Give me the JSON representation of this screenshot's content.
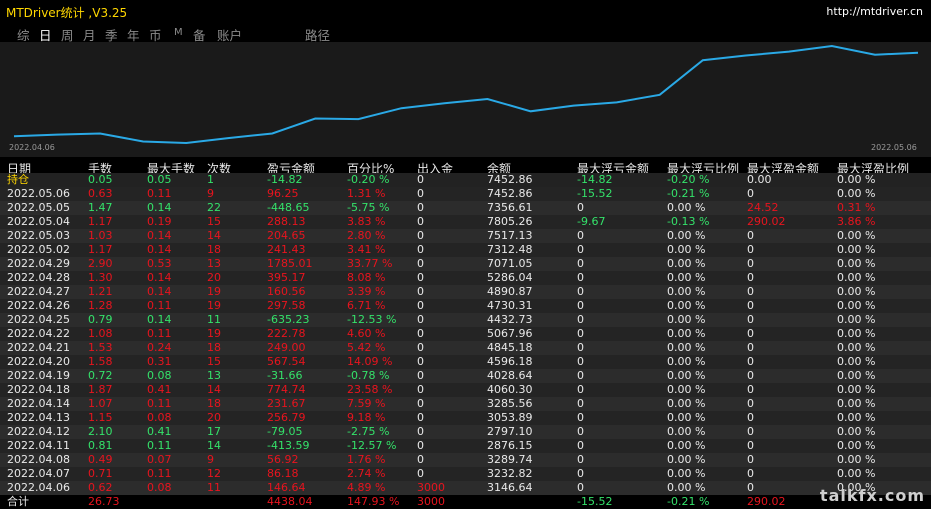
{
  "app": {
    "title": "MTDriver统计 ,V3.25",
    "url": "http://mtdriver.cn"
  },
  "tabs": [
    {
      "label": "综",
      "active": false
    },
    {
      "label": "日",
      "active": true
    },
    {
      "label": "周",
      "active": false
    },
    {
      "label": "月",
      "active": false
    },
    {
      "label": "季",
      "active": false
    },
    {
      "label": "年",
      "active": false
    },
    {
      "label": "币",
      "active": false
    },
    {
      "label": "M",
      "active": false
    },
    {
      "label": "备",
      "active": false
    },
    {
      "label": "账户",
      "active": false
    },
    {
      "label": "路径",
      "active": false
    }
  ],
  "chart_data": {
    "type": "line",
    "x_start": "2022.04.06",
    "x_end": "2022.05.06",
    "values": [
      3146.64,
      3232.82,
      3289.74,
      2876.15,
      2797.1,
      3053.89,
      3285.56,
      4060.3,
      4028.64,
      4596.18,
      4845.18,
      5067.96,
      4432.73,
      4730.31,
      4890.87,
      5286.04,
      7071.05,
      7312.48,
      7517.13,
      7805.26,
      7356.61,
      7452.86
    ],
    "color": "#2aa9e6"
  },
  "table": {
    "headers": [
      "日期",
      "手数",
      "最大手数",
      "次数",
      "盈亏金额",
      "百分比%",
      "出入金",
      "余额",
      "最大浮亏金额",
      "最大浮亏比例",
      "最大浮盈金额",
      "最大浮盈比例"
    ],
    "rows": [
      {
        "c": [
          "持仓",
          "0.05",
          "0.05",
          "1",
          "-14.82",
          "-0.20 %",
          "0",
          "7452.86",
          "-14.82",
          "-0.20 %",
          "0.00",
          "0.00 %"
        ],
        "k": [
          "y",
          "g",
          "g",
          "g",
          "g",
          "g",
          "w",
          "w",
          "g",
          "g",
          "w",
          "w"
        ]
      },
      {
        "c": [
          "2022.05.06",
          "0.63",
          "0.11",
          "9",
          "96.25",
          "1.31 %",
          "0",
          "7452.86",
          "-15.52",
          "-0.21 %",
          "0",
          "0.00 %"
        ],
        "k": [
          "w",
          "r",
          "r",
          "r",
          "r",
          "r",
          "w",
          "w",
          "g",
          "g",
          "w",
          "w"
        ]
      },
      {
        "c": [
          "2022.05.05",
          "1.47",
          "0.14",
          "22",
          "-448.65",
          "-5.75 %",
          "0",
          "7356.61",
          "0",
          "0.00 %",
          "24.52",
          "0.31 %"
        ],
        "k": [
          "w",
          "g",
          "g",
          "g",
          "g",
          "g",
          "w",
          "w",
          "w",
          "w",
          "r",
          "r"
        ]
      },
      {
        "c": [
          "2022.05.04",
          "1.17",
          "0.19",
          "15",
          "288.13",
          "3.83 %",
          "0",
          "7805.26",
          "-9.67",
          "-0.13 %",
          "290.02",
          "3.86 %"
        ],
        "k": [
          "w",
          "r",
          "r",
          "r",
          "r",
          "r",
          "w",
          "w",
          "g",
          "g",
          "r",
          "r"
        ]
      },
      {
        "c": [
          "2022.05.03",
          "1.03",
          "0.14",
          "14",
          "204.65",
          "2.80 %",
          "0",
          "7517.13",
          "0",
          "0.00 %",
          "0",
          "0.00 %"
        ],
        "k": [
          "w",
          "r",
          "r",
          "r",
          "r",
          "r",
          "w",
          "w",
          "w",
          "w",
          "w",
          "w"
        ]
      },
      {
        "c": [
          "2022.05.02",
          "1.17",
          "0.14",
          "18",
          "241.43",
          "3.41 %",
          "0",
          "7312.48",
          "0",
          "0.00 %",
          "0",
          "0.00 %"
        ],
        "k": [
          "w",
          "r",
          "r",
          "r",
          "r",
          "r",
          "w",
          "w",
          "w",
          "w",
          "w",
          "w"
        ]
      },
      {
        "c": [
          "2022.04.29",
          "2.90",
          "0.53",
          "13",
          "1785.01",
          "33.77 %",
          "0",
          "7071.05",
          "0",
          "0.00 %",
          "0",
          "0.00 %"
        ],
        "k": [
          "w",
          "r",
          "r",
          "r",
          "r",
          "r",
          "w",
          "w",
          "w",
          "w",
          "w",
          "w"
        ]
      },
      {
        "c": [
          "2022.04.28",
          "1.30",
          "0.14",
          "20",
          "395.17",
          "8.08 %",
          "0",
          "5286.04",
          "0",
          "0.00 %",
          "0",
          "0.00 %"
        ],
        "k": [
          "w",
          "r",
          "r",
          "r",
          "r",
          "r",
          "w",
          "w",
          "w",
          "w",
          "w",
          "w"
        ]
      },
      {
        "c": [
          "2022.04.27",
          "1.21",
          "0.14",
          "19",
          "160.56",
          "3.39 %",
          "0",
          "4890.87",
          "0",
          "0.00 %",
          "0",
          "0.00 %"
        ],
        "k": [
          "w",
          "r",
          "r",
          "r",
          "r",
          "r",
          "w",
          "w",
          "w",
          "w",
          "w",
          "w"
        ]
      },
      {
        "c": [
          "2022.04.26",
          "1.28",
          "0.11",
          "19",
          "297.58",
          "6.71 %",
          "0",
          "4730.31",
          "0",
          "0.00 %",
          "0",
          "0.00 %"
        ],
        "k": [
          "w",
          "r",
          "r",
          "r",
          "r",
          "r",
          "w",
          "w",
          "w",
          "w",
          "w",
          "w"
        ]
      },
      {
        "c": [
          "2022.04.25",
          "0.79",
          "0.14",
          "11",
          "-635.23",
          "-12.53 %",
          "0",
          "4432.73",
          "0",
          "0.00 %",
          "0",
          "0.00 %"
        ],
        "k": [
          "w",
          "g",
          "g",
          "g",
          "g",
          "g",
          "w",
          "w",
          "w",
          "w",
          "w",
          "w"
        ]
      },
      {
        "c": [
          "2022.04.22",
          "1.08",
          "0.11",
          "19",
          "222.78",
          "4.60 %",
          "0",
          "5067.96",
          "0",
          "0.00 %",
          "0",
          "0.00 %"
        ],
        "k": [
          "w",
          "r",
          "r",
          "r",
          "r",
          "r",
          "w",
          "w",
          "w",
          "w",
          "w",
          "w"
        ]
      },
      {
        "c": [
          "2022.04.21",
          "1.53",
          "0.24",
          "18",
          "249.00",
          "5.42 %",
          "0",
          "4845.18",
          "0",
          "0.00 %",
          "0",
          "0.00 %"
        ],
        "k": [
          "w",
          "r",
          "r",
          "r",
          "r",
          "r",
          "w",
          "w",
          "w",
          "w",
          "w",
          "w"
        ]
      },
      {
        "c": [
          "2022.04.20",
          "1.58",
          "0.31",
          "15",
          "567.54",
          "14.09 %",
          "0",
          "4596.18",
          "0",
          "0.00 %",
          "0",
          "0.00 %"
        ],
        "k": [
          "w",
          "r",
          "r",
          "r",
          "r",
          "r",
          "w",
          "w",
          "w",
          "w",
          "w",
          "w"
        ]
      },
      {
        "c": [
          "2022.04.19",
          "0.72",
          "0.08",
          "13",
          "-31.66",
          "-0.78 %",
          "0",
          "4028.64",
          "0",
          "0.00 %",
          "0",
          "0.00 %"
        ],
        "k": [
          "w",
          "g",
          "g",
          "g",
          "g",
          "g",
          "w",
          "w",
          "w",
          "w",
          "w",
          "w"
        ]
      },
      {
        "c": [
          "2022.04.18",
          "1.87",
          "0.41",
          "14",
          "774.74",
          "23.58 %",
          "0",
          "4060.30",
          "0",
          "0.00 %",
          "0",
          "0.00 %"
        ],
        "k": [
          "w",
          "r",
          "r",
          "r",
          "r",
          "r",
          "w",
          "w",
          "w",
          "w",
          "w",
          "w"
        ]
      },
      {
        "c": [
          "2022.04.14",
          "1.07",
          "0.11",
          "18",
          "231.67",
          "7.59 %",
          "0",
          "3285.56",
          "0",
          "0.00 %",
          "0",
          "0.00 %"
        ],
        "k": [
          "w",
          "r",
          "r",
          "r",
          "r",
          "r",
          "w",
          "w",
          "w",
          "w",
          "w",
          "w"
        ]
      },
      {
        "c": [
          "2022.04.13",
          "1.15",
          "0.08",
          "20",
          "256.79",
          "9.18 %",
          "0",
          "3053.89",
          "0",
          "0.00 %",
          "0",
          "0.00 %"
        ],
        "k": [
          "w",
          "r",
          "r",
          "r",
          "r",
          "r",
          "w",
          "w",
          "w",
          "w",
          "w",
          "w"
        ]
      },
      {
        "c": [
          "2022.04.12",
          "2.10",
          "0.41",
          "17",
          "-79.05",
          "-2.75 %",
          "0",
          "2797.10",
          "0",
          "0.00 %",
          "0",
          "0.00 %"
        ],
        "k": [
          "w",
          "g",
          "g",
          "g",
          "g",
          "g",
          "w",
          "w",
          "w",
          "w",
          "w",
          "w"
        ]
      },
      {
        "c": [
          "2022.04.11",
          "0.81",
          "0.11",
          "14",
          "-413.59",
          "-12.57 %",
          "0",
          "2876.15",
          "0",
          "0.00 %",
          "0",
          "0.00 %"
        ],
        "k": [
          "w",
          "g",
          "g",
          "g",
          "g",
          "g",
          "w",
          "w",
          "w",
          "w",
          "w",
          "w"
        ]
      },
      {
        "c": [
          "2022.04.08",
          "0.49",
          "0.07",
          "9",
          "56.92",
          "1.76 %",
          "0",
          "3289.74",
          "0",
          "0.00 %",
          "0",
          "0.00 %"
        ],
        "k": [
          "w",
          "r",
          "r",
          "r",
          "r",
          "r",
          "w",
          "w",
          "w",
          "w",
          "w",
          "w"
        ]
      },
      {
        "c": [
          "2022.04.07",
          "0.71",
          "0.11",
          "12",
          "86.18",
          "2.74 %",
          "0",
          "3232.82",
          "0",
          "0.00 %",
          "0",
          "0.00 %"
        ],
        "k": [
          "w",
          "r",
          "r",
          "r",
          "r",
          "r",
          "w",
          "w",
          "w",
          "w",
          "w",
          "w"
        ]
      },
      {
        "c": [
          "2022.04.06",
          "0.62",
          "0.08",
          "11",
          "146.64",
          "4.89 %",
          "3000",
          "3146.64",
          "0",
          "0.00 %",
          "0",
          "0.00 %"
        ],
        "k": [
          "w",
          "r",
          "r",
          "r",
          "r",
          "r",
          "r",
          "w",
          "w",
          "w",
          "w",
          "w"
        ]
      }
    ],
    "footer": {
      "c": [
        "合计",
        "26.73",
        "",
        "",
        "4438.04",
        "147.93 %",
        "3000",
        "",
        "-15.52",
        "-0.21 %",
        "290.02",
        ""
      ],
      "k": [
        "w",
        "r",
        "r",
        "r",
        "r",
        "r",
        "r",
        "w",
        "g",
        "g",
        "r",
        "r"
      ]
    }
  },
  "watermark": "talkfx.com",
  "colors": {
    "profit": "#e8141e",
    "loss": "#34e26a",
    "title": "#ffd700",
    "line": "#2aa9e6"
  }
}
